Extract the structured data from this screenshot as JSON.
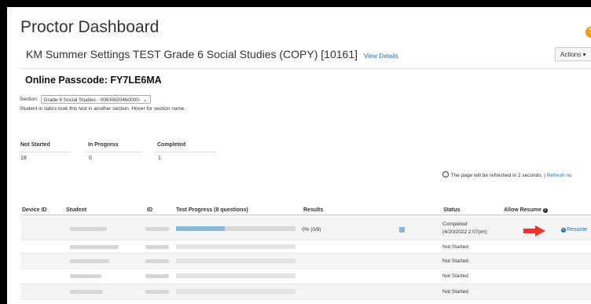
{
  "header": {
    "title": "Proctor Dashboard",
    "test_name": "KM Summer Settings TEST Grade 6 Social Studies (COPY) [10161]",
    "view_details": "View Details",
    "actions_label": "Actions ▾",
    "help_glyph": "?"
  },
  "passcode": {
    "label": "Online Passcode:",
    "value": "FY7LE6MA"
  },
  "section": {
    "label": "Section:",
    "selected": "Grade 6 Social Studies - 006X6G0460000-",
    "note": "Student in italics took this test in another section. Hover for section name."
  },
  "counts": {
    "not_started_label": "Not Started",
    "not_started": "18",
    "in_progress_label": "In Progress",
    "in_progress": "0",
    "completed_label": "Completed",
    "completed": "1"
  },
  "refresh": {
    "text": "The page will be refreshed in 2 seconds. |",
    "link": "Refresh no"
  },
  "table": {
    "headers": {
      "device_id": "Device ID",
      "student": "Student",
      "id": "ID",
      "progress": "Test Progress (8 questions)",
      "results": "Results",
      "status": "Status",
      "allow_resume": "Allow Resume"
    },
    "rows": [
      {
        "status": "Completed",
        "status_sub": "(4/20/2022 2:07pm)",
        "result": "0% (0/9)",
        "progress": 0.41,
        "resume": "Resume"
      },
      {
        "status": "Not Started"
      },
      {
        "status": "Not Started"
      },
      {
        "status": "Not Started"
      },
      {
        "status": "Not Started"
      }
    ]
  },
  "colors": {
    "link": "#1a6fb3",
    "progress_fill": "#8bb8d9",
    "arrow": "#e8332a",
    "help": "#f0a000"
  }
}
